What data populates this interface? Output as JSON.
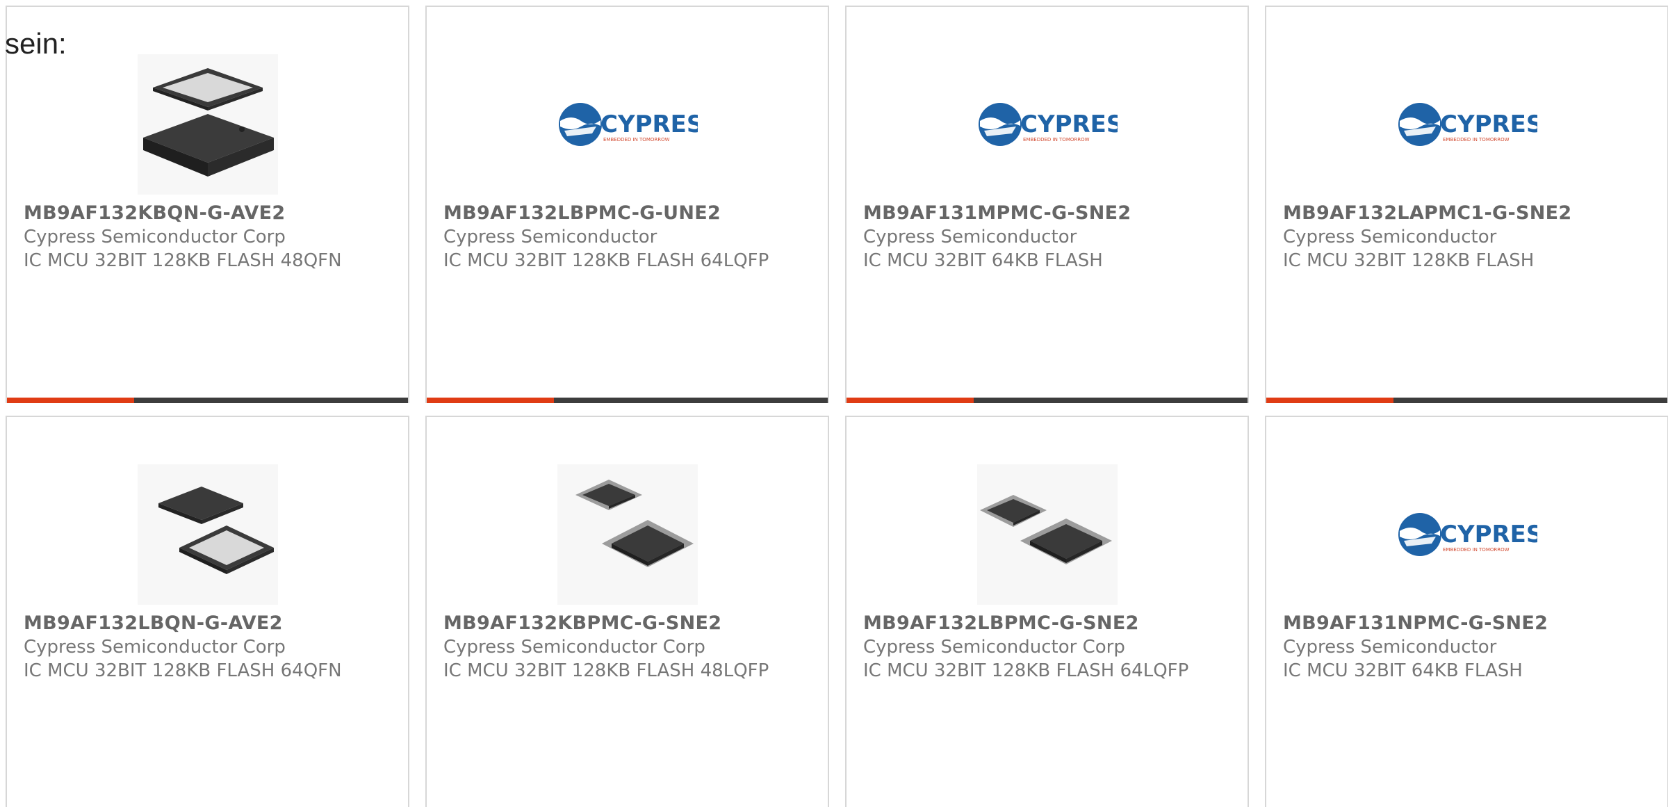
{
  "lead_text": "sein:",
  "colors": {
    "accent": "#e03c14",
    "bar": "#3d3d3d",
    "border": "#d7d7d7",
    "text": "#777777"
  },
  "cards": [
    {
      "part_number": "MB9AF132KBQN-G-AVE2",
      "manufacturer": "Cypress Semiconductor Corp",
      "description": "IC MCU 32BIT 128KB FLASH 48QFN",
      "image": "qfn-package-image"
    },
    {
      "part_number": "MB9AF132LBPMC-G-UNE2",
      "manufacturer": "Cypress Semiconductor",
      "description": "IC MCU 32BIT 128KB FLASH 64LQFP",
      "image": "cypress-logo",
      "logo_text": "CYPRESS",
      "logo_tagline": "EMBEDDED IN TOMORROW"
    },
    {
      "part_number": "MB9AF131MPMC-G-SNE2",
      "manufacturer": "Cypress Semiconductor",
      "description": "IC MCU 32BIT 64KB FLASH",
      "image": "cypress-logo",
      "logo_text": "CYPRESS",
      "logo_tagline": "EMBEDDED IN TOMORROW"
    },
    {
      "part_number": "MB9AF132LAPMC1-G-SNE2",
      "manufacturer": "Cypress Semiconductor",
      "description": "IC MCU 32BIT 128KB FLASH",
      "image": "cypress-logo",
      "logo_text": "CYPRESS",
      "logo_tagline": "EMBEDDED IN TOMORROW"
    },
    {
      "part_number": "MB9AF132LBQN-G-AVE2",
      "manufacturer": "Cypress Semiconductor Corp",
      "description": "IC MCU 32BIT 128KB FLASH 64QFN",
      "image": "qfn-package-image"
    },
    {
      "part_number": "MB9AF132KBPMC-G-SNE2",
      "manufacturer": "Cypress Semiconductor Corp",
      "description": "IC MCU 32BIT 128KB FLASH 48LQFP",
      "image": "lqfp-package-image"
    },
    {
      "part_number": "MB9AF132LBPMC-G-SNE2",
      "manufacturer": "Cypress Semiconductor Corp",
      "description": "IC MCU 32BIT 128KB FLASH 64LQFP",
      "image": "lqfp-package-image"
    },
    {
      "part_number": "MB9AF131NPMC-G-SNE2",
      "manufacturer": "Cypress Semiconductor",
      "description": "IC MCU 32BIT 64KB FLASH",
      "image": "cypress-logo",
      "logo_text": "CYPRESS",
      "logo_tagline": "EMBEDDED IN TOMORROW"
    }
  ]
}
